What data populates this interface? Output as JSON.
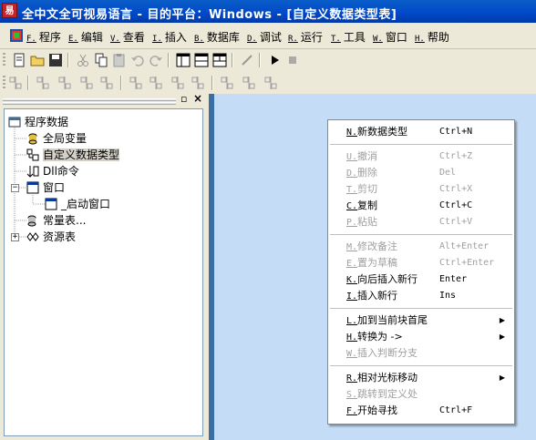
{
  "window": {
    "title": "全中文全可视易语言 - 目的平台：Windows - [自定义数据类型表]",
    "icon_letter": "易"
  },
  "menubar": [
    {
      "key": "F.",
      "label": "程序"
    },
    {
      "key": "E.",
      "label": "编辑"
    },
    {
      "key": "V.",
      "label": "查看"
    },
    {
      "key": "I.",
      "label": "插入"
    },
    {
      "key": "B.",
      "label": "数据库"
    },
    {
      "key": "D.",
      "label": "调试"
    },
    {
      "key": "R.",
      "label": "运行"
    },
    {
      "key": "T.",
      "label": "工具"
    },
    {
      "key": "W.",
      "label": "窗口"
    },
    {
      "key": "H.",
      "label": "帮助"
    }
  ],
  "panel": {
    "pin": "▫",
    "close": "×"
  },
  "tree": [
    {
      "label": "程序数据",
      "icon": "program-data-icon"
    },
    {
      "label": "全局变量",
      "icon": "global-var-icon"
    },
    {
      "label": "自定义数据类型",
      "icon": "datatype-icon",
      "selected": true
    },
    {
      "label": "Dll命令",
      "icon": "dll-icon"
    },
    {
      "label": "窗口",
      "icon": "window-icon",
      "expander": "−"
    },
    {
      "label": "_启动窗口",
      "icon": "window-icon"
    },
    {
      "label": "常量表...",
      "icon": "constants-icon"
    },
    {
      "label": "资源表",
      "icon": "resource-icon",
      "expander": "+"
    }
  ],
  "context_menu": [
    {
      "key": "N.",
      "label": "新数据类型",
      "shortcut": "Ctrl+N",
      "disabled": false
    },
    {
      "sep": true
    },
    {
      "key": "U.",
      "label": "撤消",
      "shortcut": "Ctrl+Z",
      "disabled": true
    },
    {
      "key": "D.",
      "label": "删除",
      "shortcut": "Del",
      "disabled": true
    },
    {
      "key": "T.",
      "label": "剪切",
      "shortcut": "Ctrl+X",
      "disabled": true
    },
    {
      "key": "C.",
      "label": "复制",
      "shortcut": "Ctrl+C",
      "disabled": false
    },
    {
      "key": "P.",
      "label": "粘贴",
      "shortcut": "Ctrl+V",
      "disabled": true
    },
    {
      "sep": true
    },
    {
      "key": "M.",
      "label": "修改备注",
      "shortcut": "Alt+Enter",
      "disabled": true
    },
    {
      "key": "E.",
      "label": "置为草稿",
      "shortcut": "Ctrl+Enter",
      "disabled": true
    },
    {
      "key": "K.",
      "label": "向后插入新行",
      "shortcut": "Enter",
      "disabled": false
    },
    {
      "key": "I.",
      "label": "插入新行",
      "shortcut": "Ins",
      "disabled": false
    },
    {
      "sep": true
    },
    {
      "key": "L.",
      "label": "加到当前块首尾",
      "submenu": true,
      "disabled": false
    },
    {
      "key": "H.",
      "label": "转换为 ->",
      "submenu": true,
      "disabled": false
    },
    {
      "key": "W.",
      "label": "插入判断分支",
      "disabled": true
    },
    {
      "sep": true
    },
    {
      "key": "R.",
      "label": "相对光标移动",
      "submenu": true,
      "disabled": false
    },
    {
      "key": "S.",
      "label": "跳转到定义处",
      "disabled": true
    },
    {
      "key": "F.",
      "label": "开始寻找",
      "shortcut": "Ctrl+F",
      "disabled": false
    }
  ],
  "colors": {
    "titlebar": "#0054e3",
    "workarea": "#c4dcf6",
    "divider": "#3a6ea5"
  }
}
